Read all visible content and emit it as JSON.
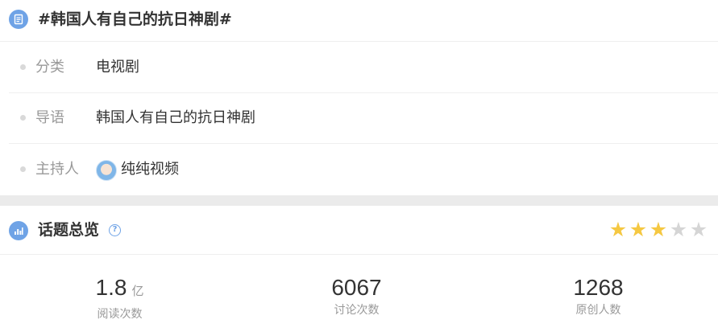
{
  "topic": {
    "title": "#韩国人有自己的抗日神剧#"
  },
  "info": {
    "category_label": "分类",
    "category_value": "电视剧",
    "intro_label": "导语",
    "intro_value": "韩国人有自己的抗日神剧",
    "host_label": "主持人",
    "host_value": "纯纯视频"
  },
  "overview": {
    "title": "话题总览",
    "help_icon": "?",
    "rating": 3,
    "rating_max": 5,
    "stats": [
      {
        "value": "1.8",
        "unit": "亿",
        "label": "阅读次数"
      },
      {
        "value": "6067",
        "unit": "",
        "label": "讨论次数"
      },
      {
        "value": "1268",
        "unit": "",
        "label": "原创人数"
      }
    ]
  },
  "icons": {
    "head_icon": "document-icon",
    "overview_icon": "chart-icon",
    "help": "help-icon",
    "star": "star-icon"
  },
  "colors": {
    "accent": "#6fa3e6",
    "star_on": "#f5c842",
    "star_off": "#d5d5d5",
    "label": "#999999",
    "text": "#333333"
  }
}
